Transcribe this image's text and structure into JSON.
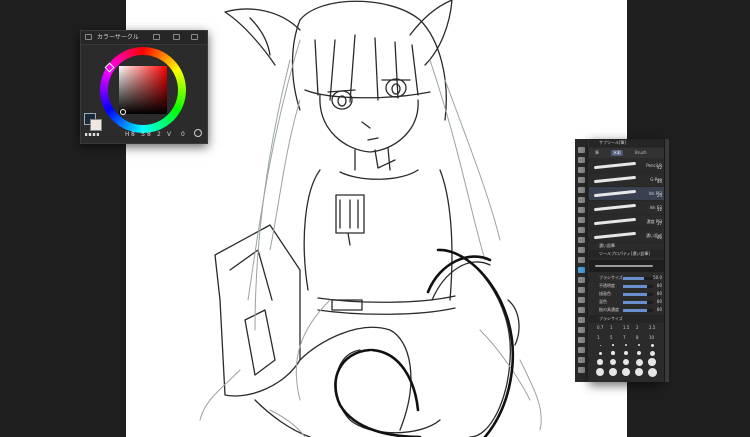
{
  "color_panel": {
    "title": "カラーサークル",
    "main_color": "#1a2a3a",
    "sub_color": "#f1e7e2",
    "hue_color": "#ff0000",
    "readouts": [
      "H",
      "S",
      "V",
      "0"
    ],
    "numeric_values": [
      "8",
      "8",
      "2",
      "0"
    ]
  },
  "toolbar": {
    "tools": [
      "pen",
      "pencil",
      "brush",
      "airbrush",
      "blend",
      "eraser",
      "fill",
      "gradient",
      "figure",
      "text",
      "operation",
      "move",
      "lasso",
      "selection",
      "eyedropper",
      "ruler",
      "frame",
      "balloon",
      "correct-line",
      "hand",
      "zoom",
      "layer-move",
      "color-set"
    ],
    "active_index": 12
  },
  "subtool_panel": {
    "header_title": "サブツール[筆]",
    "tabs": [
      "筆",
      "水彩",
      "Brush",
      "厚塗り"
    ],
    "brushes": [
      {
        "name": "Pencil R",
        "count": "42"
      },
      {
        "name": "G-Pen",
        "count": "46"
      },
      {
        "name": "Ink PSI",
        "count": "20"
      },
      {
        "name": "Ink 52",
        "count": "52"
      },
      {
        "name": "濃度 PSI",
        "count": "37"
      },
      {
        "name": "濃い混ぜ",
        "count": "40"
      }
    ],
    "selected_brush": "濃い鉛筆",
    "properties_header": "ツールプロパティ[濃い鉛筆]",
    "properties": [
      {
        "label": "ブラシサイズ",
        "value": "50.0",
        "fill": 0.7
      },
      {
        "label": "不透明度",
        "value": "80",
        "fill": 0.8
      },
      {
        "label": "描画色",
        "value": "80",
        "fill": 0.8
      },
      {
        "label": "混色",
        "value": "80",
        "fill": 0.8
      },
      {
        "label": "絵の具濃度",
        "value": "80",
        "fill": 0.8
      }
    ],
    "size_header": "ブラシサイズ",
    "size_labels": [
      "0.7",
      "1",
      "1.5",
      "2",
      "2.5"
    ],
    "size_labels2": [
      "1",
      "5",
      "7",
      "8",
      "10"
    ]
  }
}
